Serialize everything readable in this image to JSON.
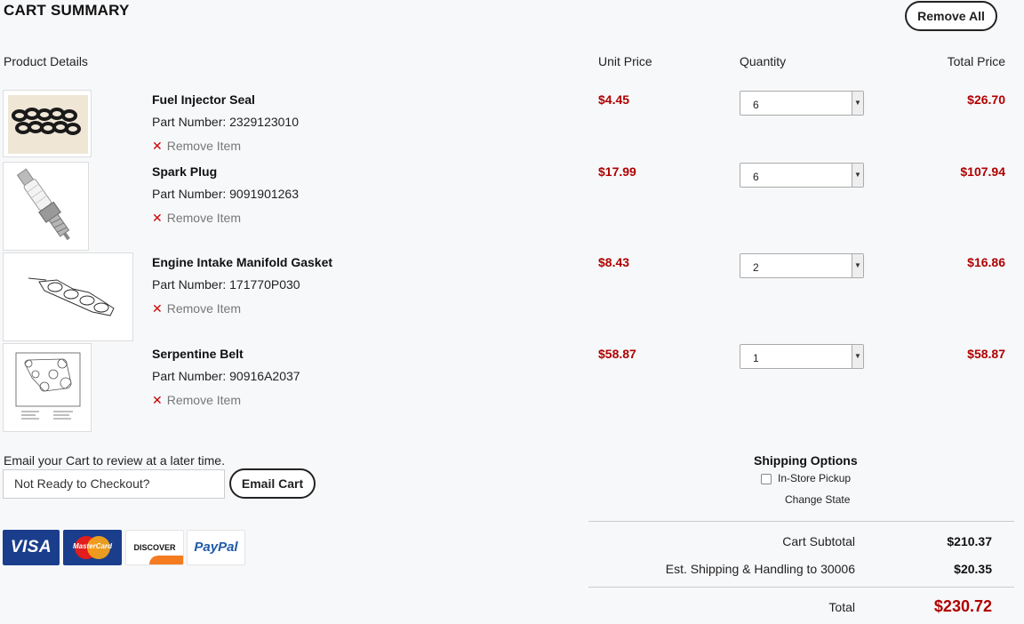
{
  "header": {
    "title": "CART SUMMARY",
    "remove_all_label": "Remove All"
  },
  "columns": {
    "product": "Product Details",
    "unit_price": "Unit Price",
    "quantity": "Quantity",
    "total_price": "Total Price"
  },
  "items": [
    {
      "name": "Fuel Injector Seal",
      "part_number": "Part Number: 2329123010",
      "remove_label": "Remove Item",
      "unit_price": "$4.45",
      "quantity": "6",
      "total": "$26.70",
      "image": "o-ring-seals-image"
    },
    {
      "name": "Spark Plug",
      "part_number": "Part Number: 9091901263",
      "remove_label": "Remove Item",
      "unit_price": "$17.99",
      "quantity": "6",
      "total": "$107.94",
      "image": "spark-plug-image"
    },
    {
      "name": "Engine Intake Manifold Gasket",
      "part_number": "Part Number: 171770P030",
      "remove_label": "Remove Item",
      "unit_price": "$8.43",
      "quantity": "2",
      "total": "$16.86",
      "image": "gasket-drawing-image"
    },
    {
      "name": "Serpentine Belt",
      "part_number": "Part Number: 90916A2037",
      "remove_label": "Remove Item",
      "unit_price": "$58.87",
      "quantity": "1",
      "total": "$58.87",
      "image": "belt-diagram-image"
    }
  ],
  "email": {
    "label": "Email your Cart to review at a later time.",
    "input_value": "Not Ready to Checkout?",
    "button_label": "Email Cart"
  },
  "shipping": {
    "title": "Shipping Options",
    "option_label": "In-Store Pickup",
    "option_checked": false,
    "change_state_label": "Change State"
  },
  "summary": {
    "subtotal_label": "Cart Subtotal",
    "subtotal_value": "$210.37",
    "shipping_label": "Est. Shipping & Handling to 30006",
    "shipping_value": "$20.35",
    "total_label": "Total",
    "total_value": "$230.72"
  },
  "payment_cards": {
    "visa": "VISA",
    "mastercard": "MasterCard",
    "discover": "DISCOVER",
    "paypal": "PayPal"
  },
  "colors": {
    "accent_red": "#b00000",
    "visa_blue": "#1a3e8c",
    "discover_orange": "#f47b20",
    "paypal_blue": "#1f5aa8"
  }
}
